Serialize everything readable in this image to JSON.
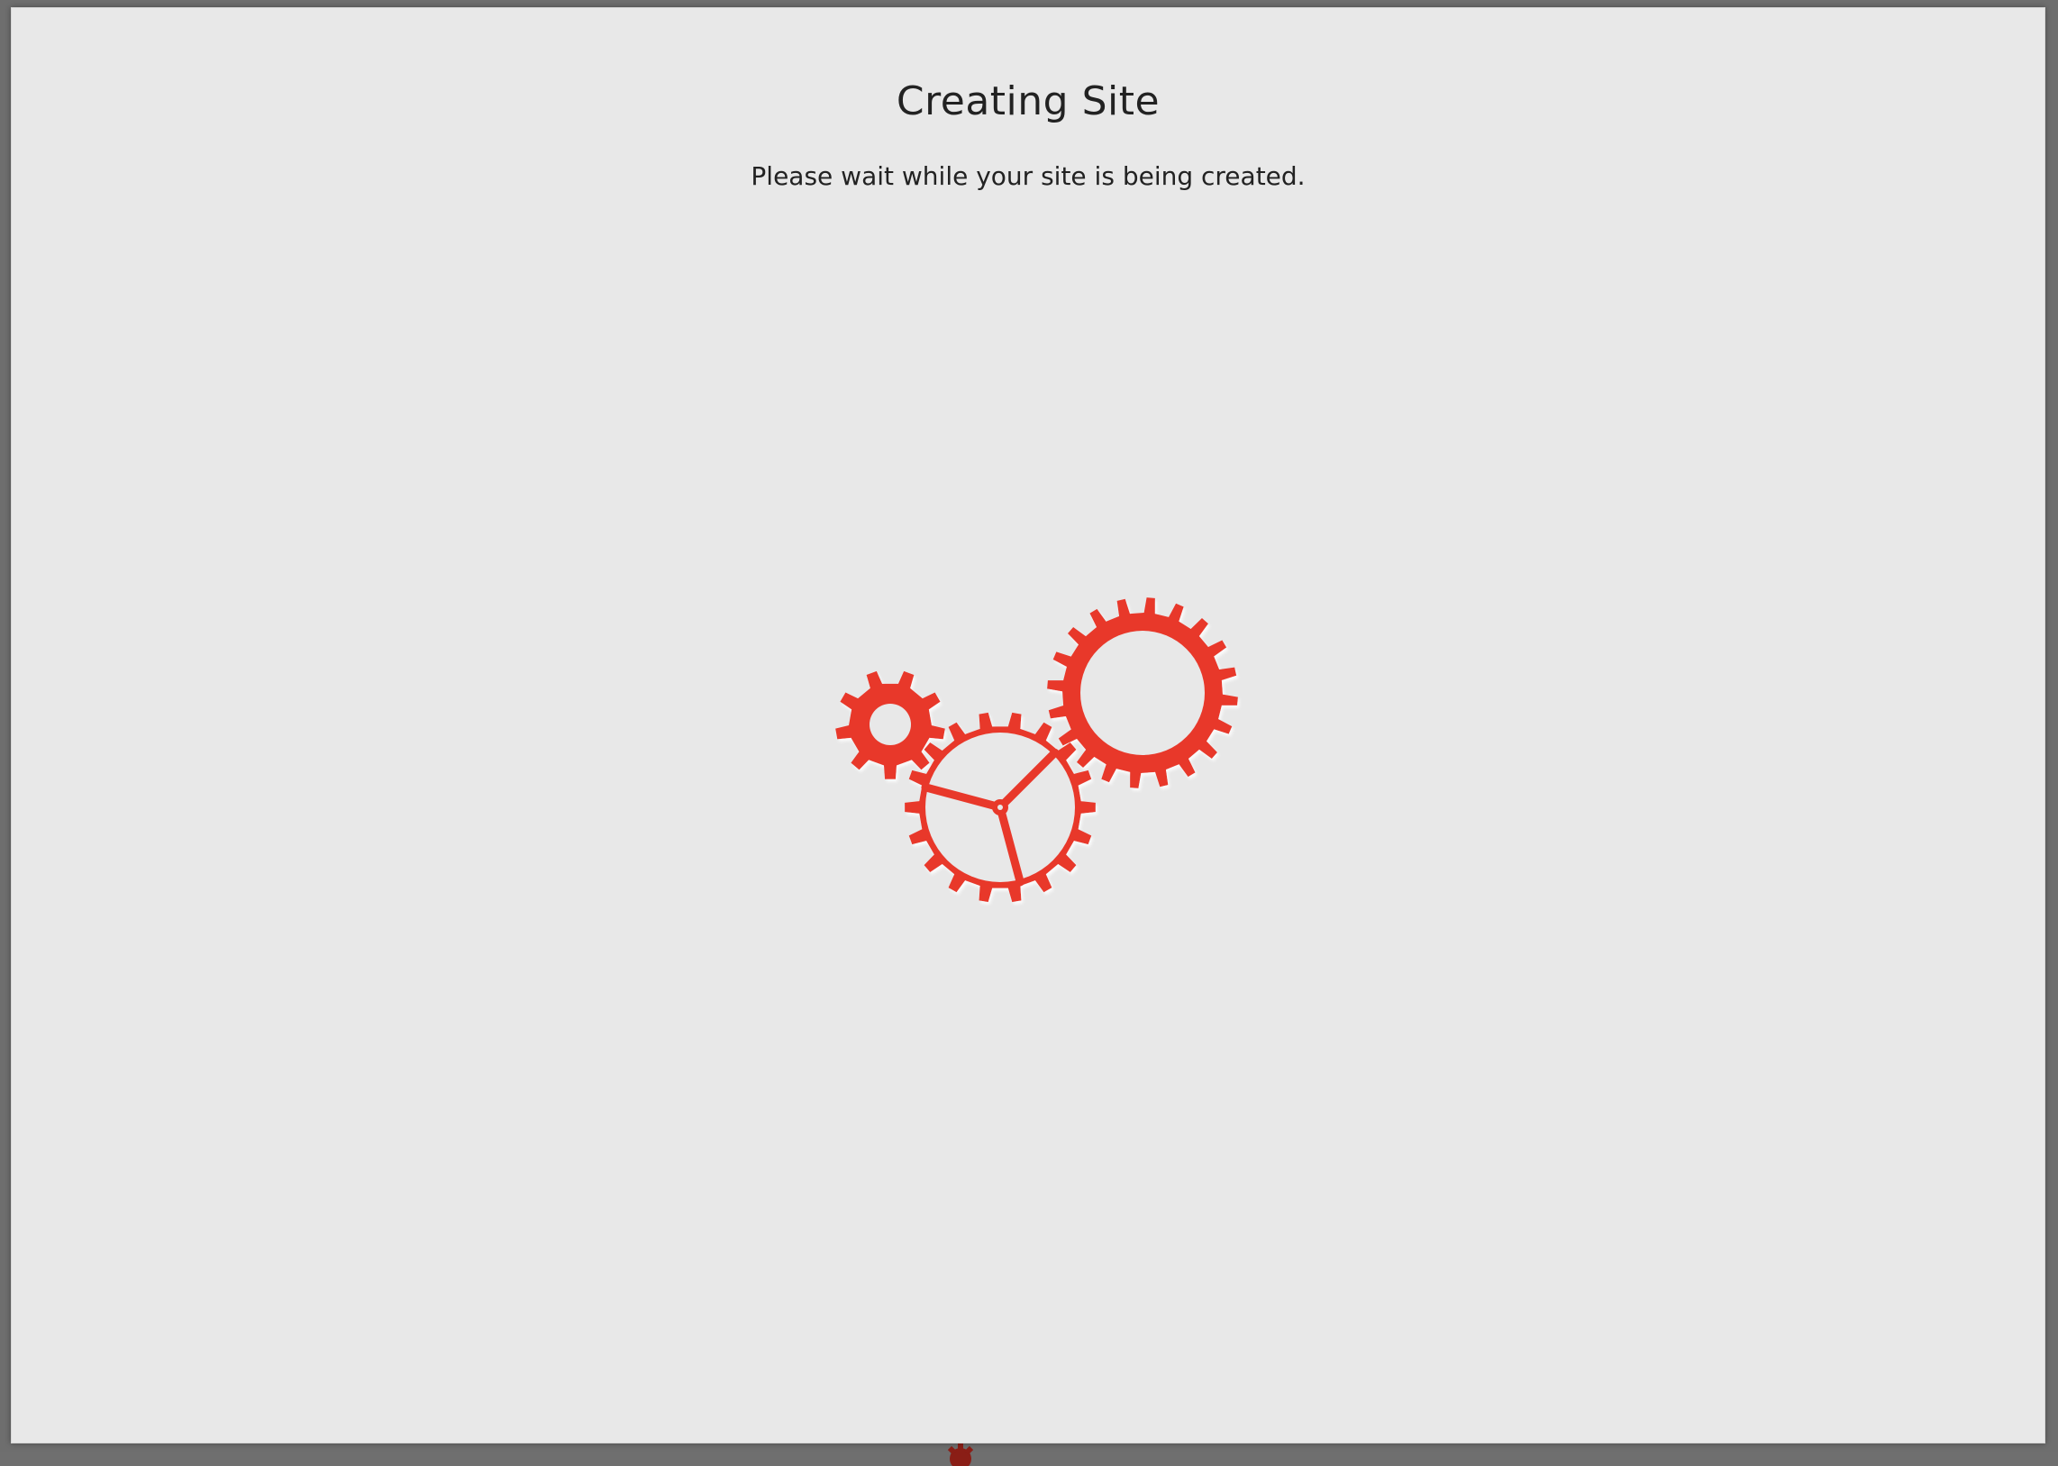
{
  "dialog": {
    "title": "Creating Site",
    "message": "Please wait while your site is being created."
  },
  "loader": {
    "icon": "gears-loading-icon",
    "color": "#e8382b"
  },
  "colors": {
    "backdrop": "#6e6e6e",
    "dialog_background": "#e8e8e8",
    "text": "#222222",
    "accent": "#e8382b"
  }
}
